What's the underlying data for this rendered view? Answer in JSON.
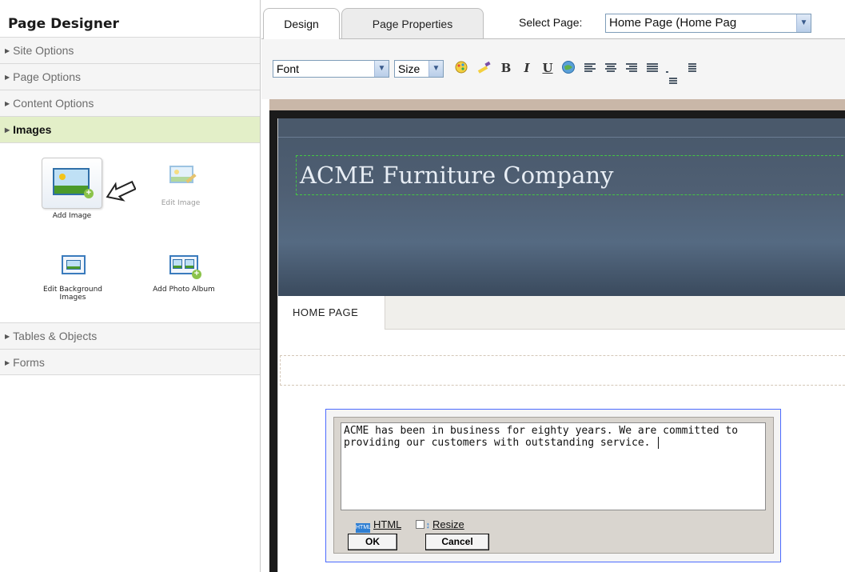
{
  "sidebar": {
    "title": "Page Designer",
    "sections": [
      {
        "label": "Site Options"
      },
      {
        "label": "Page Options"
      },
      {
        "label": "Content Options"
      },
      {
        "label": "Images"
      },
      {
        "label": "Tables & Objects"
      },
      {
        "label": "Forms"
      }
    ],
    "active_section": "Images",
    "image_tools": [
      {
        "label": "Add Image",
        "enabled": true
      },
      {
        "label": "Edit Image",
        "enabled": false
      },
      {
        "label": "Edit Background Images",
        "enabled": true
      },
      {
        "label": "Add Photo Album",
        "enabled": true
      }
    ]
  },
  "tabs": [
    {
      "label": "Design",
      "active": true
    },
    {
      "label": "Page Properties",
      "active": false
    }
  ],
  "select_page": {
    "label": "Select Page:",
    "value": "Home Page (Home Pag"
  },
  "toolbar": {
    "font_value": "Font",
    "size_value": "Size",
    "buttons": [
      "colors-icon",
      "highlight-icon",
      "bold-icon",
      "italic-icon",
      "underline-icon",
      "link-icon",
      "align-left-icon",
      "align-center-icon",
      "align-right-icon",
      "justify-icon",
      "numbered-list-icon",
      "bullet-list-icon"
    ],
    "bold_glyph": "B",
    "italic_glyph": "I",
    "underline_glyph": "U"
  },
  "page": {
    "site_title": "ACME Furniture Company",
    "nav_tab": "HOME PAGE"
  },
  "editor": {
    "content": "ACME has been in business for eighty years. We are committed to providing our customers with outstanding service.",
    "html_link": "HTML",
    "resize_link": "Resize",
    "ok_label": "OK",
    "cancel_label": "Cancel"
  },
  "colors": {
    "active_section_bg": "#e3efc8",
    "header_band": "#4f5f73",
    "editor_border": "#4c6bff"
  }
}
